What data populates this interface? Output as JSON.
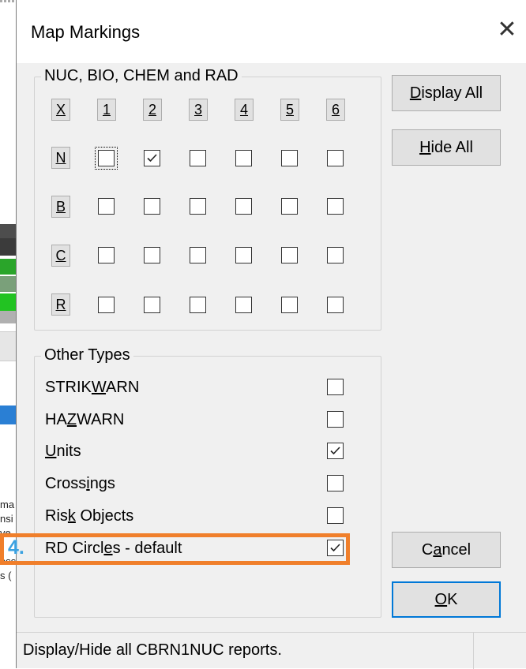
{
  "background_app": {
    "text_fragments": [
      "ma",
      "nsi",
      "ve",
      "ess",
      "s ("
    ]
  },
  "dialog": {
    "title": "Map Markings",
    "close_icon": "close-icon"
  },
  "group_nbcr": {
    "label": "NUC, BIO, CHEM and RAD",
    "corner_button": "X",
    "column_headers": [
      "1",
      "2",
      "3",
      "4",
      "5",
      "6"
    ],
    "rows": [
      {
        "label": "N",
        "checks": [
          false,
          true,
          false,
          false,
          false,
          false
        ]
      },
      {
        "label": "B",
        "checks": [
          false,
          false,
          false,
          false,
          false,
          false
        ]
      },
      {
        "label": "C",
        "checks": [
          false,
          false,
          false,
          false,
          false,
          false
        ]
      },
      {
        "label": "R",
        "checks": [
          false,
          false,
          false,
          false,
          false,
          false
        ]
      }
    ]
  },
  "group_other": {
    "label": "Other Types",
    "items": [
      {
        "pre": "STRIK",
        "accel": "W",
        "post": "ARN",
        "checked": false
      },
      {
        "pre": "HA",
        "accel": "Z",
        "post": "WARN",
        "checked": false
      },
      {
        "pre": "",
        "accel": "U",
        "post": "nits",
        "checked": true
      },
      {
        "pre": "Cross",
        "accel": "i",
        "post": "ngs",
        "checked": false
      },
      {
        "pre": "Ris",
        "accel": "k",
        "post": " Objects",
        "checked": false
      },
      {
        "pre": "RD Circl",
        "accel": "e",
        "post": "s - default",
        "checked": true
      }
    ]
  },
  "buttons": {
    "display_all": {
      "accel": "D",
      "rest": "isplay All"
    },
    "hide_all": {
      "accel": "H",
      "rest": "ide All"
    },
    "cancel": {
      "pre": "C",
      "accel": "a",
      "post": "ncel"
    },
    "ok": {
      "accel": "O",
      "rest": "K"
    }
  },
  "status_bar": {
    "text": "Display/Hide all CBRN1NUC reports."
  },
  "annotation": {
    "step_number": "4.",
    "highlight_color": "#f07f2b",
    "number_color": "#3ba1e0"
  }
}
